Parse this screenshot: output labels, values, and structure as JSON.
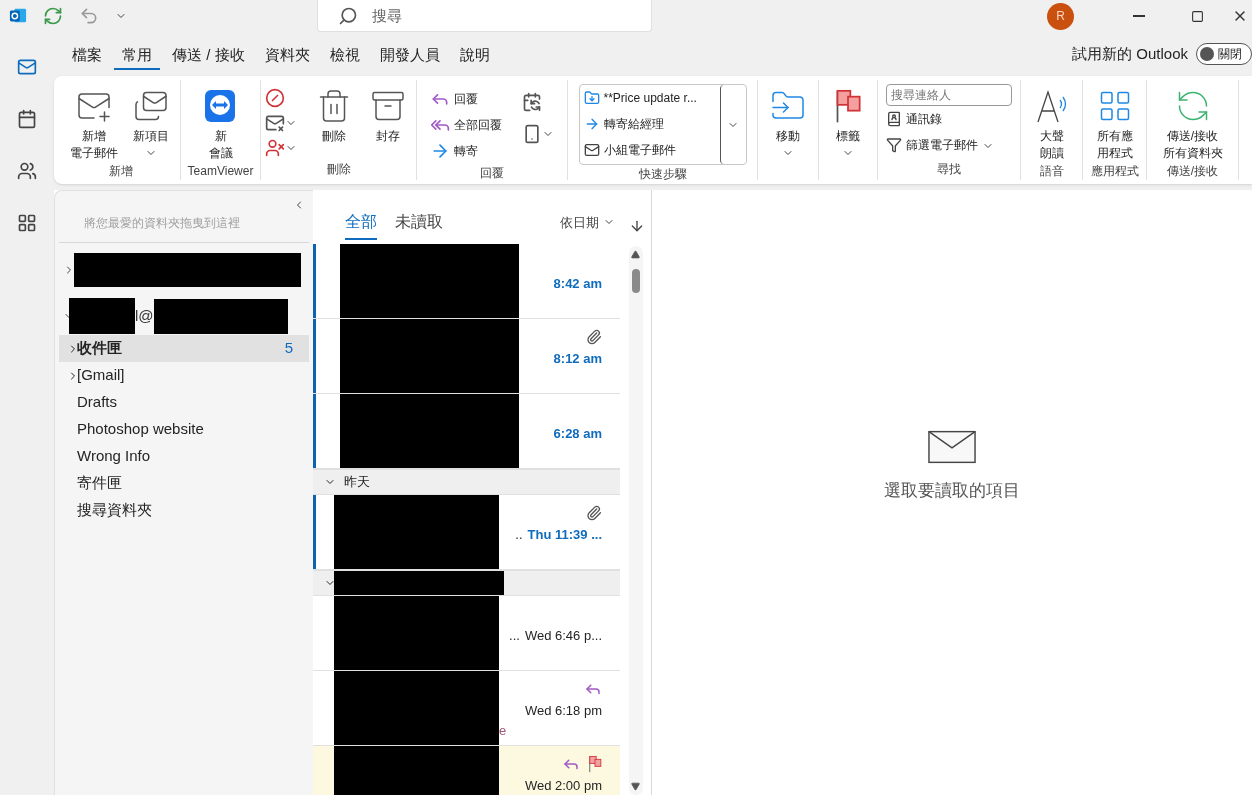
{
  "title_bar": {
    "search": {
      "placeholder": "搜尋"
    },
    "avatar": "R"
  },
  "menu_tabs": [
    {
      "label": "檔案",
      "selected": false
    },
    {
      "label": "常用",
      "selected": true
    },
    {
      "label": "傳送 / 接收",
      "selected": false
    },
    {
      "label": "資料夾",
      "selected": false
    },
    {
      "label": "檢視",
      "selected": false
    },
    {
      "label": "開發人員",
      "selected": false
    },
    {
      "label": "說明",
      "selected": false
    }
  ],
  "new_outlook": {
    "label": "試用新的 Outlook",
    "toggle": {
      "label": "關閉",
      "on": false
    }
  },
  "ribbon": {
    "groups": [
      {
        "kind": "new",
        "label": "新增",
        "buttons": [
          {
            "lines": [
              "新增",
              "電子郵件"
            ],
            "dropdown": false
          },
          {
            "lines": [
              "新項目"
            ],
            "dropdown": true
          }
        ]
      },
      {
        "kind": "teamviewer",
        "label": "TeamViewer",
        "buttons": [
          {
            "lines": [
              "新",
              "會議"
            ],
            "dropdown": false
          }
        ]
      },
      {
        "kind": "delete",
        "label": "刪除",
        "buttons": [
          {
            "lines": [
              "刪除"
            ],
            "dropdown": false
          },
          {
            "lines": [
              "封存"
            ],
            "dropdown": false
          }
        ]
      },
      {
        "kind": "respond",
        "label": "回覆",
        "buttons": [
          {
            "label": "回覆"
          },
          {
            "label": "全部回覆"
          },
          {
            "label": "轉寄"
          }
        ]
      },
      {
        "kind": "quick_steps",
        "label": "快速步驟",
        "buttons": [
          {
            "label": "**Price update r..."
          },
          {
            "label": "轉寄給經理"
          },
          {
            "label": "小組電子郵件"
          }
        ]
      },
      {
        "kind": "move",
        "buttons": [
          {
            "lines": [
              "移動"
            ],
            "dropdown": true
          }
        ]
      },
      {
        "kind": "tags",
        "buttons": [
          {
            "lines": [
              "標籤"
            ],
            "dropdown": true
          }
        ]
      },
      {
        "kind": "find",
        "label": "尋找",
        "search": {
          "placeholder": "搜尋連絡人"
        },
        "buttons": [
          {
            "label": "通訊錄"
          },
          {
            "label": "篩選電子郵件",
            "dropdown": true
          }
        ]
      },
      {
        "kind": "speech",
        "label": "語音",
        "buttons": [
          {
            "lines": [
              "大聲",
              "朗讀"
            ],
            "dropdown": false
          }
        ]
      },
      {
        "kind": "apps",
        "label": "應用程式",
        "buttons": [
          {
            "lines": [
              "所有應",
              "用程式"
            ],
            "dropdown": false
          }
        ]
      },
      {
        "kind": "sync",
        "label": "傳送/接收",
        "buttons": [
          {
            "lines": [
              "傳送/接收",
              "所有資料夾"
            ],
            "dropdown": false
          }
        ]
      }
    ]
  },
  "folder_pane": {
    "favorites_hint": "將您最愛的資料夾拖曳到這裡",
    "accounts": [
      {
        "expanded": false
      },
      {
        "expanded": true,
        "name_fragment": "l@",
        "children": [
          {
            "name": "收件匣",
            "selected": true,
            "count": "5",
            "expanded": false
          },
          {
            "name": "[Gmail]",
            "selected": false,
            "expanded": false
          },
          {
            "name": "Drafts",
            "selected": false
          },
          {
            "name": "Photoshop website",
            "selected": false
          },
          {
            "name": "Wrong Info",
            "selected": false
          },
          {
            "name": "寄件匣",
            "selected": false
          },
          {
            "name": "搜尋資料夾",
            "selected": false
          }
        ]
      }
    ]
  },
  "message_list": {
    "tabs": [
      {
        "label": "全部",
        "selected": true
      },
      {
        "label": "未讀取",
        "selected": false
      }
    ],
    "sort": {
      "label": "依日期"
    },
    "items": [
      {
        "kind": "message",
        "time": "8:42 am",
        "unread": true,
        "attachment": false,
        "replied": false,
        "flagged": false
      },
      {
        "kind": "message",
        "time": "8:12 am",
        "unread": true,
        "attachment": true,
        "replied": false,
        "flagged": false
      },
      {
        "kind": "message",
        "time": "6:28 am",
        "unread": true,
        "attachment": false,
        "replied": false,
        "flagged": false
      },
      {
        "kind": "header",
        "label": "昨天",
        "expanded": true
      },
      {
        "kind": "message",
        "time": "Thu 11:39 ...",
        "subject_fragment": "..",
        "unread": true,
        "attachment": true,
        "replied": false,
        "flagged": false
      },
      {
        "kind": "header",
        "expanded": true
      },
      {
        "kind": "message",
        "time": "Wed 6:46 p...",
        "subject_fragment": "...",
        "unread": false,
        "attachment": false,
        "replied": false,
        "flagged": false
      },
      {
        "kind": "message",
        "time": "Wed 6:18 pm",
        "preview_fragment": "e",
        "unread": false,
        "attachment": false,
        "replied": true,
        "flagged": false
      },
      {
        "kind": "message",
        "time": "Wed 2:00 pm",
        "unread": false,
        "attachment": false,
        "replied": true,
        "flagged": true
      }
    ]
  },
  "reading_pane": {
    "empty_message": "選取要讀取的項目"
  }
}
